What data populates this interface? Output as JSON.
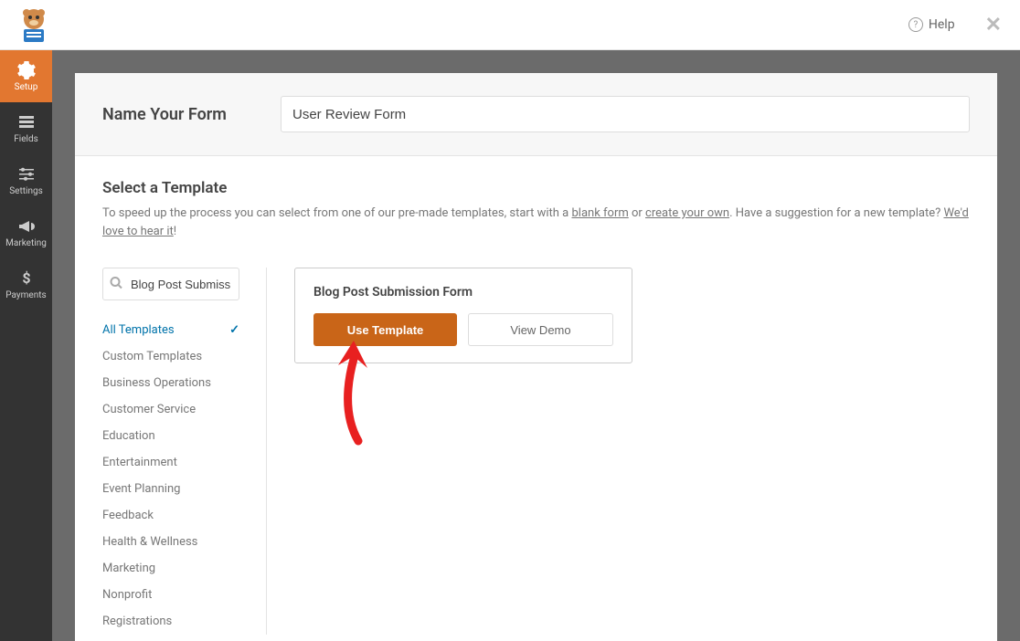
{
  "topbar": {
    "help_label": "Help"
  },
  "sidebar": {
    "items": [
      {
        "label": "Setup",
        "icon": "gear"
      },
      {
        "label": "Fields",
        "icon": "list"
      },
      {
        "label": "Settings",
        "icon": "sliders"
      },
      {
        "label": "Marketing",
        "icon": "megaphone"
      },
      {
        "label": "Payments",
        "icon": "dollar"
      }
    ]
  },
  "form": {
    "name_label": "Name Your Form",
    "name_value": "User Review Form"
  },
  "templates": {
    "heading": "Select a Template",
    "desc_1": "To speed up the process you can select from one of our pre-made templates, start with a ",
    "desc_link_blank": "blank form",
    "desc_2": " or ",
    "desc_link_create": "create your own",
    "desc_3": ". Have a suggestion for a new template? ",
    "desc_link_suggest": "We'd love to hear it",
    "desc_4": "!",
    "search_value": "Blog Post Submission",
    "categories": [
      "All Templates",
      "Custom Templates",
      "Business Operations",
      "Customer Service",
      "Education",
      "Entertainment",
      "Event Planning",
      "Feedback",
      "Health & Wellness",
      "Marketing",
      "Nonprofit",
      "Registrations"
    ],
    "card": {
      "title": "Blog Post Submission Form",
      "use_label": "Use Template",
      "demo_label": "View Demo"
    }
  }
}
